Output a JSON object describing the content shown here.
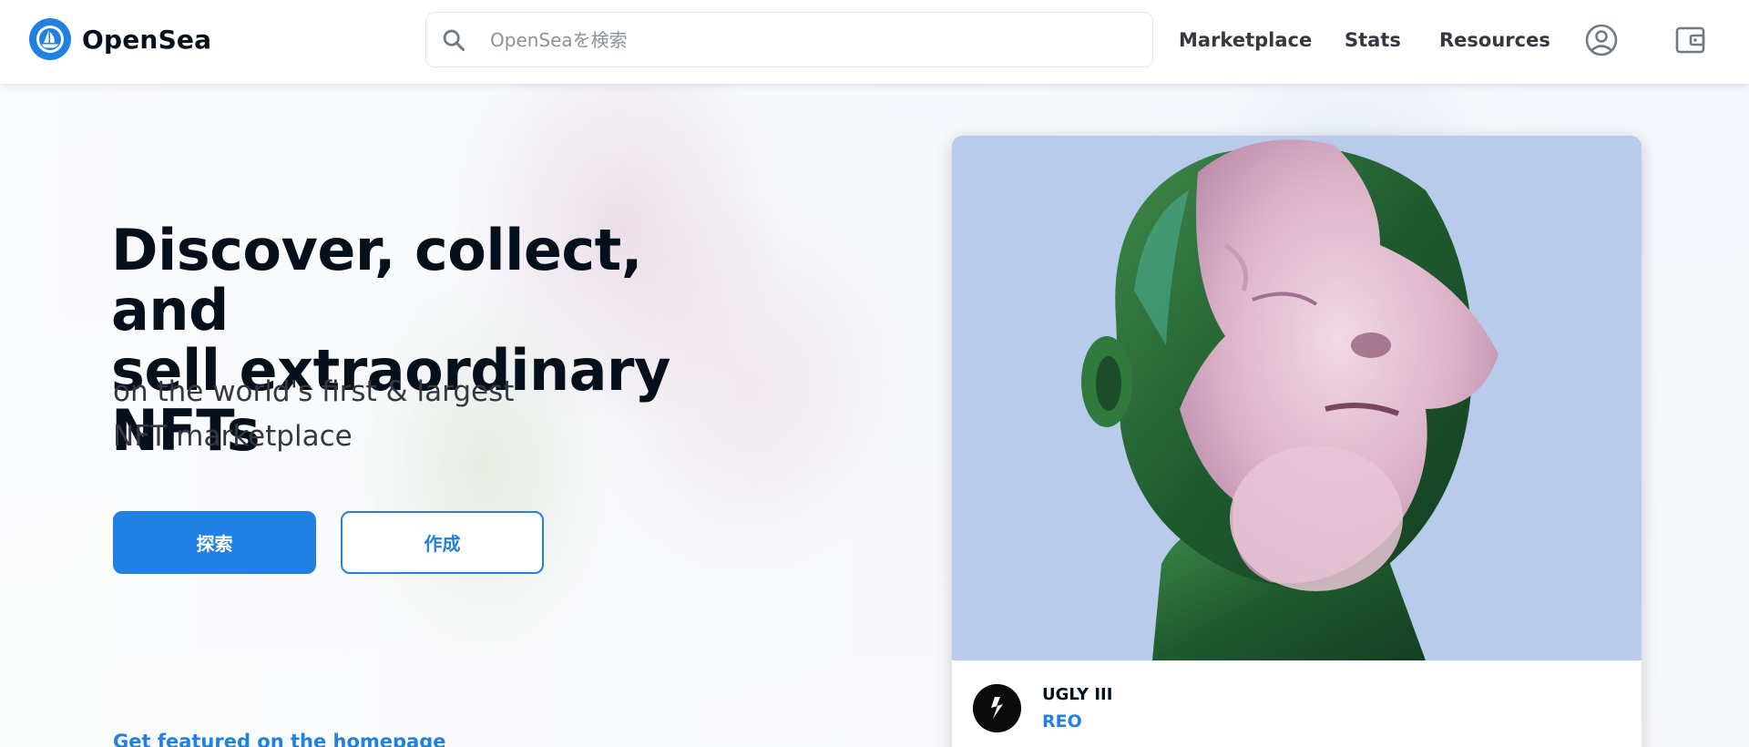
{
  "brand": {
    "name": "OpenSea",
    "accent_color": "#2081e2",
    "logo_icon": "opensea-logo-icon"
  },
  "search": {
    "placeholder": "OpenSeaを検索",
    "value": "",
    "icon": "search-icon"
  },
  "nav": {
    "links": [
      {
        "label": "Marketplace"
      },
      {
        "label": "Stats"
      },
      {
        "label": "Resources"
      }
    ],
    "profile_icon": "account-circle-icon",
    "wallet_icon": "wallet-icon"
  },
  "hero": {
    "title_line1": "Discover, collect, and",
    "title_line2": "sell extraordinary NFTs",
    "subtitle_line1": "on the world's first & largest",
    "subtitle_line2": "NFT marketplace",
    "explore_label": "探索",
    "create_label": "作成",
    "featured_link": "Get featured on the homepage"
  },
  "featured_card": {
    "name": "UGLY III",
    "creator": "REO",
    "art_background": "#b9cbeb"
  }
}
